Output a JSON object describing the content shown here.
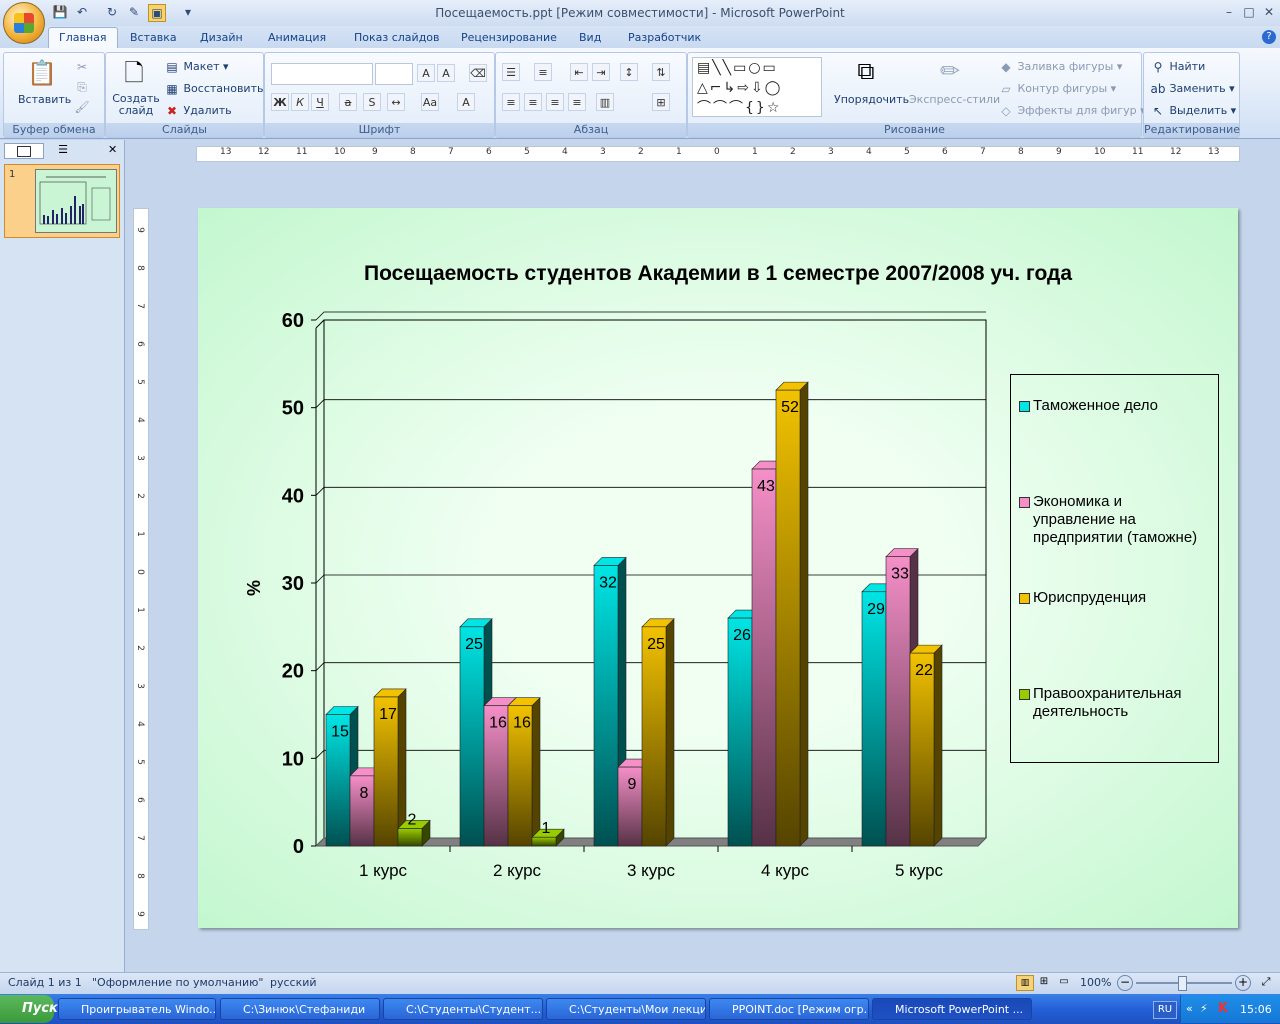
{
  "window": {
    "title": "Посещаемость.ppt [Режим совместимости] - Microsoft PowerPoint",
    "controls": [
      "–",
      "□",
      "✕"
    ]
  },
  "tabs": [
    {
      "label": "Главная",
      "active": true
    },
    {
      "label": "Вставка"
    },
    {
      "label": "Дизайн"
    },
    {
      "label": "Анимация"
    },
    {
      "label": "Показ слайдов"
    },
    {
      "label": "Рецензирование"
    },
    {
      "label": "Вид"
    },
    {
      "label": "Разработчик"
    }
  ],
  "ribbon": {
    "clipboard": {
      "label": "Буфер обмена",
      "paste": "Вставить"
    },
    "slides": {
      "label": "Слайды",
      "new_slide": "Создать слайд",
      "layout": "Макет",
      "reset": "Восстановить",
      "delete": "Удалить"
    },
    "font": {
      "label": "Шрифт"
    },
    "paragraph": {
      "label": "Абзац"
    },
    "drawing": {
      "label": "Рисование",
      "arrange": "Упорядочить",
      "quick_styles": "Экспресс-стили",
      "shape_fill": "Заливка фигуры",
      "shape_outline": "Контур фигуры",
      "shape_effects": "Эффекты для фигур"
    },
    "editing": {
      "label": "Редактирование",
      "find": "Найти",
      "replace": "Заменить",
      "select": "Выделить"
    }
  },
  "left_panel": {
    "slide_number": "1"
  },
  "chart_data": {
    "type": "bar",
    "title": "Посещаемость студентов Академии в 1 семестре 2007/2008 уч. года",
    "ylabel": "%",
    "xlabel": "",
    "ylim": [
      0,
      60
    ],
    "yticks": [
      "0",
      "10",
      "20",
      "30",
      "40",
      "50",
      "60"
    ],
    "grid": true,
    "legend": "right",
    "categories": [
      "1 курс",
      "2 курс",
      "3 курс",
      "4 курс",
      "5 курс"
    ],
    "series": [
      {
        "name": "Таможенное дело",
        "color": "#00e5e5",
        "values": [
          15,
          25,
          32,
          26,
          29
        ]
      },
      {
        "name": "Экономика и управление на предприятии (таможне)",
        "color": "#f58fc8",
        "values": [
          8,
          16,
          9,
          43,
          33
        ]
      },
      {
        "name": "Юриспруденция",
        "color": "#f2c200",
        "values": [
          17,
          16,
          25,
          52,
          22
        ]
      },
      {
        "name": "Правоохранительная деятельность",
        "color": "#99cc00",
        "values": [
          2,
          1,
          null,
          null,
          null
        ]
      }
    ],
    "legend_lines": [
      [
        "Таможенное дело"
      ],
      [
        "Экономика и",
        "управление на",
        "предприятии (таможне)"
      ],
      [
        "Юриспруденция"
      ],
      [
        "Правоохранительная",
        "деятельность"
      ]
    ]
  },
  "status": {
    "slide": "Слайд 1 из 1",
    "theme": "\"Оформление по умолчанию\"",
    "language": "русский",
    "zoom": "100%"
  },
  "taskbar": {
    "start": "Пуск",
    "items": [
      "Проигрыватель Windo...",
      "C:\\Зинюк\\Стефаниди",
      "C:\\Студенты\\Студент...",
      "C:\\Студенты\\Мои лекции",
      "PPOINT.doc [Режим огр...",
      "Microsoft PowerPoint ..."
    ],
    "lang": "RU",
    "time": "15:06"
  }
}
